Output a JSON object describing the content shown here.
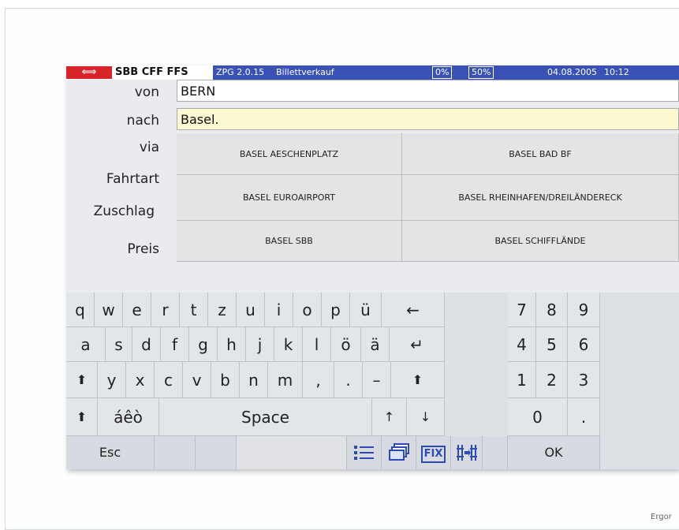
{
  "titlebar": {
    "logo": "⟺",
    "brand": "SBB CFF FFS",
    "app": "ZPG 2.0.15",
    "module": "Billettverkauf",
    "pct1": "0%",
    "pct2": "50%",
    "date": "04.08.2005",
    "time": "10:12"
  },
  "form": {
    "labels": {
      "von": "von",
      "nach": "nach",
      "via": "via",
      "fahrtart": "Fahrtart",
      "zuschlag": "Zuschlag",
      "preis": "Preis"
    },
    "von_value": "BERN",
    "nach_value": "Basel."
  },
  "suggestions": [
    "BASEL AESCHENPLATZ",
    "BASEL BAD BF",
    "BASEL EUROAIRPORT",
    "BASEL RHEINHAFEN/DREILÄNDERECK",
    "BASEL SBB",
    "BASEL SCHIFFLÄNDE"
  ],
  "keyboard": {
    "row1": [
      "q",
      "w",
      "e",
      "r",
      "t",
      "z",
      "u",
      "i",
      "o",
      "p",
      "ü",
      "←"
    ],
    "row2": [
      "a",
      "s",
      "d",
      "f",
      "g",
      "h",
      "j",
      "k",
      "l",
      "ö",
      "ä",
      "↵"
    ],
    "row3": [
      "⬆",
      "y",
      "x",
      "c",
      "v",
      "b",
      "n",
      "m",
      ",",
      ".",
      "–",
      "⬆"
    ],
    "row4": {
      "shift": "⬆",
      "accents": "áêò",
      "space": "Space",
      "up": "↑",
      "down": "↓"
    },
    "numpad": [
      "7",
      "8",
      "9",
      "4",
      "5",
      "6",
      "1",
      "2",
      "3",
      "0",
      "."
    ],
    "fkeys": {
      "esc": "Esc",
      "fix": "FIX",
      "ok": "OK"
    }
  },
  "colors": {
    "titlebar": "#3a52b8",
    "logo": "#d8232a",
    "nach_field": "#fbf8d2"
  },
  "footer": "Ergor"
}
